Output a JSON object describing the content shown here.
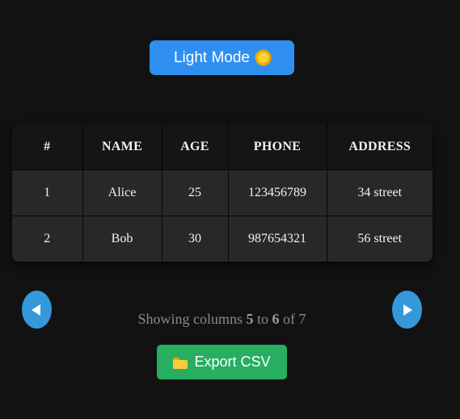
{
  "theme_toggle": {
    "label": "Light Mode",
    "icon": "sun-icon"
  },
  "table": {
    "headers": [
      "#",
      "NAME",
      "AGE",
      "PHONE",
      "ADDRESS"
    ],
    "rows": [
      [
        "1",
        "Alice",
        "25",
        "123456789",
        "34 street"
      ],
      [
        "2",
        "Bob",
        "30",
        "987654321",
        "56 street"
      ]
    ]
  },
  "pagination": {
    "prev_icon": "chevron-left-icon",
    "next_icon": "chevron-right-icon",
    "text_prefix": "Showing columns",
    "from": "5",
    "text_to": "to",
    "to": "6",
    "text_of": "of",
    "total": "7"
  },
  "export": {
    "label": "Export CSV",
    "icon": "folder-icon"
  },
  "colors": {
    "background": "#121212",
    "theme_button": "#2f8ff0",
    "nav_button": "#3498db",
    "export_button": "#27ae60"
  }
}
